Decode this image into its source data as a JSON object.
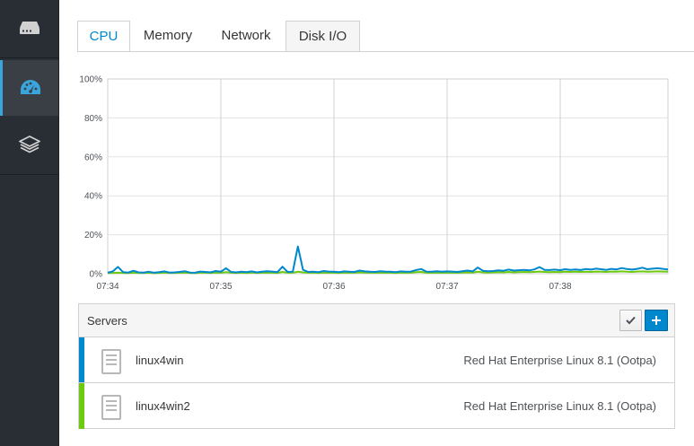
{
  "sidebar": {
    "items": [
      {
        "icon": "server-icon",
        "label": "Host"
      },
      {
        "icon": "dashboard-icon",
        "label": "Dashboard",
        "active": true
      },
      {
        "icon": "layers-icon",
        "label": "Applications"
      }
    ]
  },
  "tabs": [
    {
      "label": "CPU",
      "active": true
    },
    {
      "label": "Memory"
    },
    {
      "label": "Network"
    },
    {
      "label": "Disk I/O"
    }
  ],
  "chart_data": {
    "type": "line",
    "ylim": [
      0,
      100
    ],
    "y_ticks": [
      "100%",
      "80%",
      "60%",
      "40%",
      "20%",
      "0%"
    ],
    "x_ticks": [
      "07:34",
      "07:35",
      "07:36",
      "07:37",
      "07:38"
    ],
    "grid": true,
    "series": [
      {
        "color": "#0088ce",
        "values": [
          0.5,
          1.2,
          3.5,
          0.8,
          0.6,
          1.5,
          0.7,
          0.6,
          1.0,
          0.5,
          0.8,
          1.2,
          0.6,
          0.7,
          0.9,
          1.3,
          0.6,
          0.5,
          1.1,
          0.9,
          0.7,
          1.4,
          1.0,
          2.8,
          0.9,
          0.7,
          1.0,
          0.8,
          1.2,
          0.7,
          1.0,
          1.3,
          1.1,
          0.8,
          3.6,
          0.9,
          1.0,
          14.0,
          2.0,
          0.9,
          1.0,
          0.8,
          1.4,
          1.1,
          1.0,
          0.8,
          1.2,
          1.0,
          0.9,
          1.6,
          1.2,
          1.0,
          0.9,
          1.3,
          1.1,
          1.0,
          0.8,
          1.2,
          1.0,
          1.1,
          1.9,
          2.4,
          1.1,
          1.0,
          1.3,
          1.0,
          1.2,
          1.1,
          0.9,
          1.3,
          1.6,
          1.2,
          3.2,
          1.5,
          1.3,
          1.4,
          1.7,
          1.5,
          2.1,
          1.6,
          1.8,
          2.0,
          1.7,
          2.2,
          3.4,
          2.0,
          1.9,
          2.1,
          1.8,
          2.3,
          2.0,
          2.2,
          1.9,
          2.4,
          2.1,
          2.6,
          2.3,
          2.0,
          2.5,
          2.2,
          2.9,
          2.4,
          2.1,
          2.5,
          3.1,
          2.3,
          2.6,
          2.8,
          2.5,
          2.2
        ]
      },
      {
        "color": "#6ec90f",
        "values": [
          0.3,
          0.4,
          0.5,
          0.4,
          0.3,
          0.5,
          0.4,
          0.4,
          0.5,
          0.3,
          0.4,
          0.6,
          0.4,
          0.4,
          0.5,
          0.6,
          0.4,
          0.3,
          0.5,
          0.5,
          0.4,
          0.6,
          0.5,
          0.8,
          0.5,
          0.4,
          0.5,
          0.4,
          0.6,
          0.4,
          0.5,
          0.6,
          0.5,
          0.4,
          0.9,
          0.5,
          0.5,
          1.0,
          0.7,
          0.5,
          0.5,
          0.4,
          0.6,
          0.5,
          0.5,
          0.4,
          0.6,
          0.5,
          0.5,
          0.7,
          0.6,
          0.5,
          0.5,
          0.6,
          0.5,
          0.5,
          0.4,
          0.6,
          0.5,
          0.5,
          0.8,
          0.9,
          0.5,
          0.5,
          0.6,
          0.5,
          0.6,
          0.5,
          0.5,
          0.6,
          0.7,
          0.6,
          1.0,
          0.7,
          0.6,
          0.7,
          0.8,
          0.7,
          0.9,
          0.7,
          0.8,
          0.9,
          0.8,
          0.9,
          1.1,
          0.9,
          0.8,
          0.9,
          0.8,
          1.0,
          0.9,
          1.0,
          0.9,
          1.0,
          0.9,
          1.1,
          1.0,
          0.9,
          1.1,
          1.0,
          1.2,
          1.0,
          0.9,
          1.1,
          1.2,
          1.0,
          1.1,
          1.2,
          1.1,
          1.0
        ]
      }
    ]
  },
  "servers": {
    "title": "Servers",
    "rows": [
      {
        "name": "linux4win",
        "os": "Red Hat Enterprise Linux 8.1 (Ootpa)",
        "color": "#0088ce"
      },
      {
        "name": "linux4win2",
        "os": "Red Hat Enterprise Linux 8.1 (Ootpa)",
        "color": "#6ec90f"
      }
    ]
  }
}
